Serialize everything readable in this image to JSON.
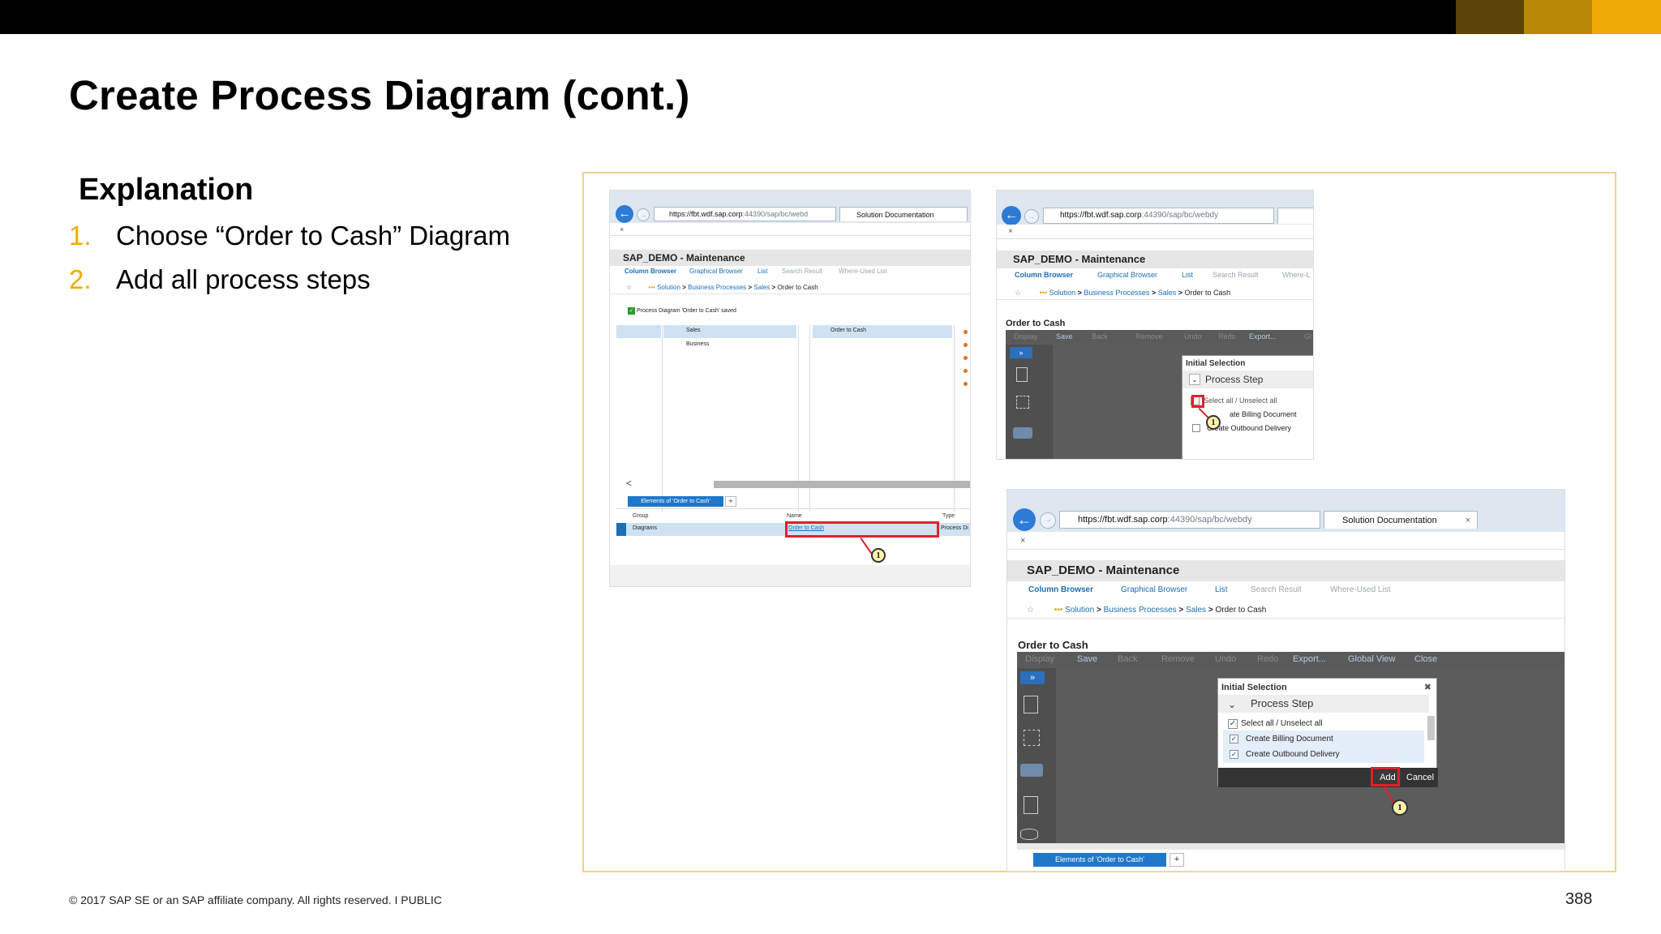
{
  "slide": {
    "title": "Create Process Diagram (cont.)",
    "explanation_heading": "Explanation",
    "steps": [
      {
        "num": "1.",
        "text": "Choose “Order to Cash” Diagram"
      },
      {
        "num": "2.",
        "text": "Add all process steps"
      }
    ],
    "footer": "© 2017 SAP SE or an SAP affiliate company. All rights reserved.   I   PUBLIC",
    "page_number": "388",
    "colors": {
      "accent": "#f0ab00",
      "frame": "#f2d18a",
      "topbar": "#000000"
    }
  },
  "browser": {
    "url_domain_short": "https://fbt.wdf.sap.corp",
    "url_rest_short": ":44390/sap/bc/webd",
    "url_domain": "https://fbt.wdf.sap.corp",
    "url_rest": ":44390/sap/bc/webdy",
    "tab_label": "Solution Documentation",
    "close_glyph": "×",
    "back_icon": "←"
  },
  "app": {
    "title": "SAP_DEMO - Maintenance",
    "nav": [
      "Column Browser",
      "Graphical Browser",
      "List",
      "Search Result",
      "Where-Used List"
    ],
    "nav_short_last": "Where-L",
    "breadcrumb": [
      "Solution",
      "Business Processes",
      "Sales",
      "Order to Cash"
    ],
    "breadcrumb_sep": ">",
    "dots": "•••"
  },
  "shot1": {
    "saved_message": "Process Diagram 'Order to Cash' saved",
    "column1": [
      "Sales",
      "Business"
    ],
    "column2": [
      "Order to Cash"
    ],
    "bottom_tab": "Elements of 'Order to Cash'",
    "plus": "+",
    "table_headers": [
      "Group",
      "Name",
      "Type"
    ],
    "table_row": {
      "group": "Diagrams",
      "name": "Order to Cash",
      "type": "Process Di"
    },
    "callout": "1",
    "scroll_left": "<"
  },
  "shot2": {
    "section": "Order to Cash",
    "menu": [
      "Display",
      "Save",
      "Back",
      "Remove",
      "Undo",
      "Redo",
      "Export...",
      "Gl"
    ],
    "dialog_title": "Initial Selection",
    "group": "Process Step",
    "options": [
      "Select all / Unselect all",
      "ate Billing Document",
      "Create Outbound Delivery"
    ],
    "callout": "1"
  },
  "shot3": {
    "section": "Order to Cash",
    "menu": [
      "Display",
      "Save",
      "Back",
      "Remove",
      "Undo",
      "Redo",
      "Export...",
      "Global View",
      "Close"
    ],
    "dialog_title": "Initial Selection",
    "group": "Process Step",
    "options": [
      "Select all / Unselect all",
      "Create Billing Document",
      "Create Outbound Delivery"
    ],
    "check_glyph": "✓",
    "add_label": "Add",
    "cancel_label": "Cancel",
    "bottom_tab": "Elements of 'Order to Cash'",
    "plus": "+",
    "callout": "1",
    "close_dialog_glyph": "✖"
  }
}
